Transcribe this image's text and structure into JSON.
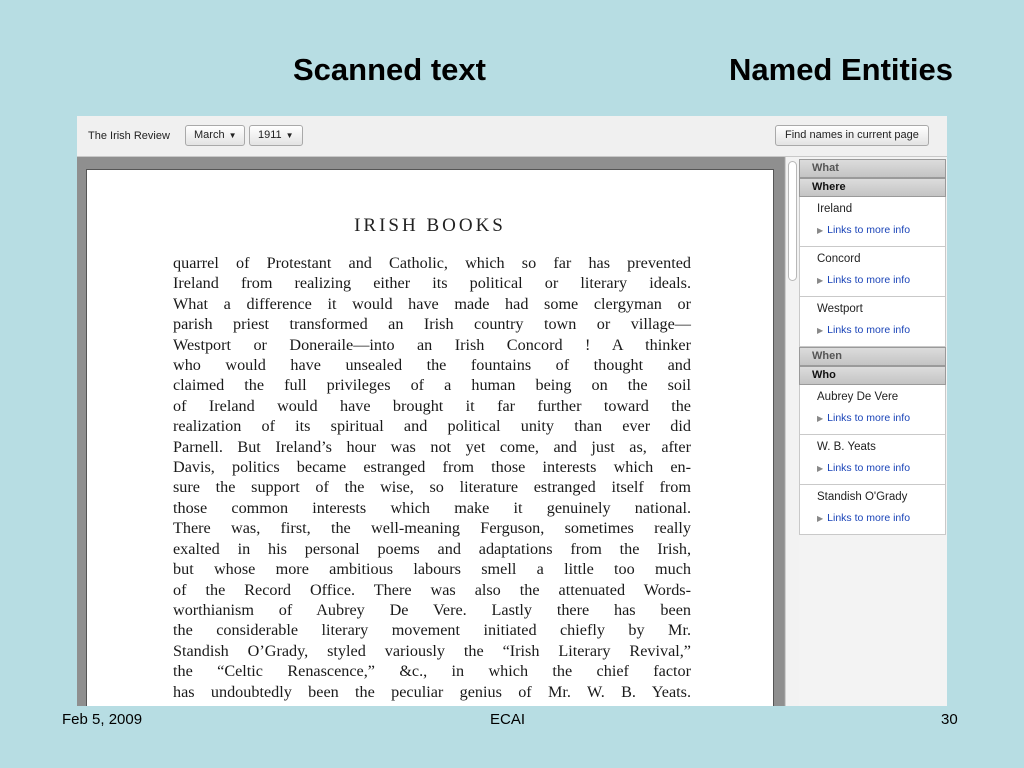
{
  "slide": {
    "title_left": "Scanned text",
    "title_right": "Named Entities",
    "footer_date": "Feb 5, 2009",
    "footer_center": "ECAI",
    "footer_page": "30"
  },
  "toolbar": {
    "publication": "The Irish Review",
    "month": "March",
    "year": "1911",
    "find_names_label": "Find names in current page"
  },
  "document": {
    "heading": "IRISH BOOKS",
    "lines": [
      "quarrel of Protestant and Catholic, which so far has prevented",
      "Ireland from realizing either its political or literary ideals.",
      "What a difference it would have made had some clergyman or",
      "parish priest transformed an Irish country town or village—",
      "Westport or Doneraile—into an Irish Concord ! A thinker",
      "who would have unsealed the fountains of thought and",
      "claimed the full privileges of a human being on the soil",
      "of Ireland would have brought it far further toward the",
      "realization of its spiritual and political unity than ever did",
      "Parnell. But Ireland’s hour was not yet come, and just as, after",
      "Davis, politics became estranged from those interests which en-",
      "sure the support of the wise, so literature estranged itself from",
      "those common interests which make it genuinely national.",
      "There was, first, the well-meaning Ferguson, sometimes really",
      "exalted in his personal poems and adaptations from the Irish,",
      "but whose more ambitious labours smell a little too much",
      "of the Record Office. There was also the attenuated Words-",
      "worthianism of Aubrey De Vere. Lastly there has been",
      "the considerable literary movement initiated chiefly by Mr.",
      "Standish O’Grady, styled variously the “Irish Literary Revival,”",
      "the “Celtic Renascence,” &c., in which the chief factor",
      "has undoubtedly been the peculiar genius of Mr. W. B. Yeats."
    ]
  },
  "panel": {
    "what_label": "What",
    "where_label": "Where",
    "when_label": "When",
    "who_label": "Who",
    "link_label": "Links to more info",
    "where": [
      "Ireland",
      "Concord",
      "Westport"
    ],
    "who": [
      "Aubrey De Vere",
      "W. B. Yeats",
      "Standish O'Grady"
    ]
  }
}
